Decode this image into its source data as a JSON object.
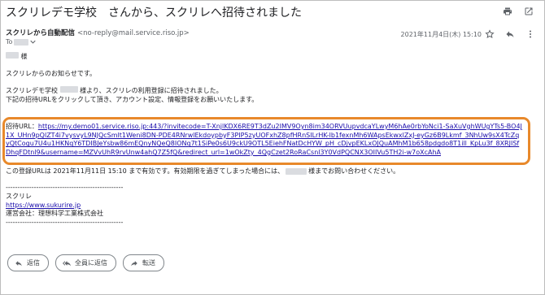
{
  "email": {
    "subject": "スクリレデモ学校　さんから、スクリレへ招待されました",
    "sender_name": "スクリレから自動配信",
    "sender_email": "<no-reply@mail.service.riso.jp>",
    "to_label": "To",
    "date": "2021年11月4日(木) 15:10",
    "salutation_suffix": "様",
    "body_lines": [
      "スクリレからのお知らせです。",
      "スクリレデモ学校",
      "様より、スクリレの利用登録に招待されました。",
      "下記の招待URLをクリックして頂き、アカウント設定、情報登録をお願いいたします。"
    ],
    "invite_label": "招待URL：",
    "invite_url": "https://my.demo01.service.riso.jp:443/?invitecode=T-XnjlKDX6RE9T3dZu2IMV9Oyn8im34ORVUupvdcaYLwyM6hAe0rbYoNci1-SaXuVghWUgYTs5-BO4J1X_UHn9pQlZT4i7vysvyL9NJQcSmlt1Weni8DN-PDE4RNrwlEkdoypbyF3PIP5zyUOFxhZ8pfHRnSILrHK-lb1fexnMh6WApsEkwxlZxJ-eyGz6B9Lkmf_3NhUw9sX4TcZqyQtCogu7U4u1HKNqY6TDIBJeYsbw86mEQnyNQeQ8IONq7t1SiPe0s6U9ckU9OTL5EiehFNatDcHYW_pH_cDjvpEKLxOJQuAMhM1b658pdgdo8T1ill_KpLu3f_8XRJISfDhqFDtnl9&username=MZVvUhR9rvUnw4ahQ7Z5fQ&redirect_url=1wOkZty_4QgCzet2RoRaCsnl3Y0VdPQCNX3OIIVu5TH2i-w7oXcAhA",
    "expiry_prefix": "この登録URLは 2021年11月11日 15:10 まで有効です。有効期限を過ぎてしまった場合には、",
    "expiry_suffix": "様までお問い合わせください。",
    "divider": "--------------------------------------------------",
    "sig_name": "スクリレ",
    "sig_url": "https://www.sukurire.jp",
    "sig_company": "運営会社：理想科学工業株式会社"
  },
  "actions": {
    "reply": "返信",
    "reply_all": "全員に返信",
    "forward": "転送"
  },
  "colors": {
    "highlight": "#e8892b",
    "link": "#1a0dab"
  }
}
